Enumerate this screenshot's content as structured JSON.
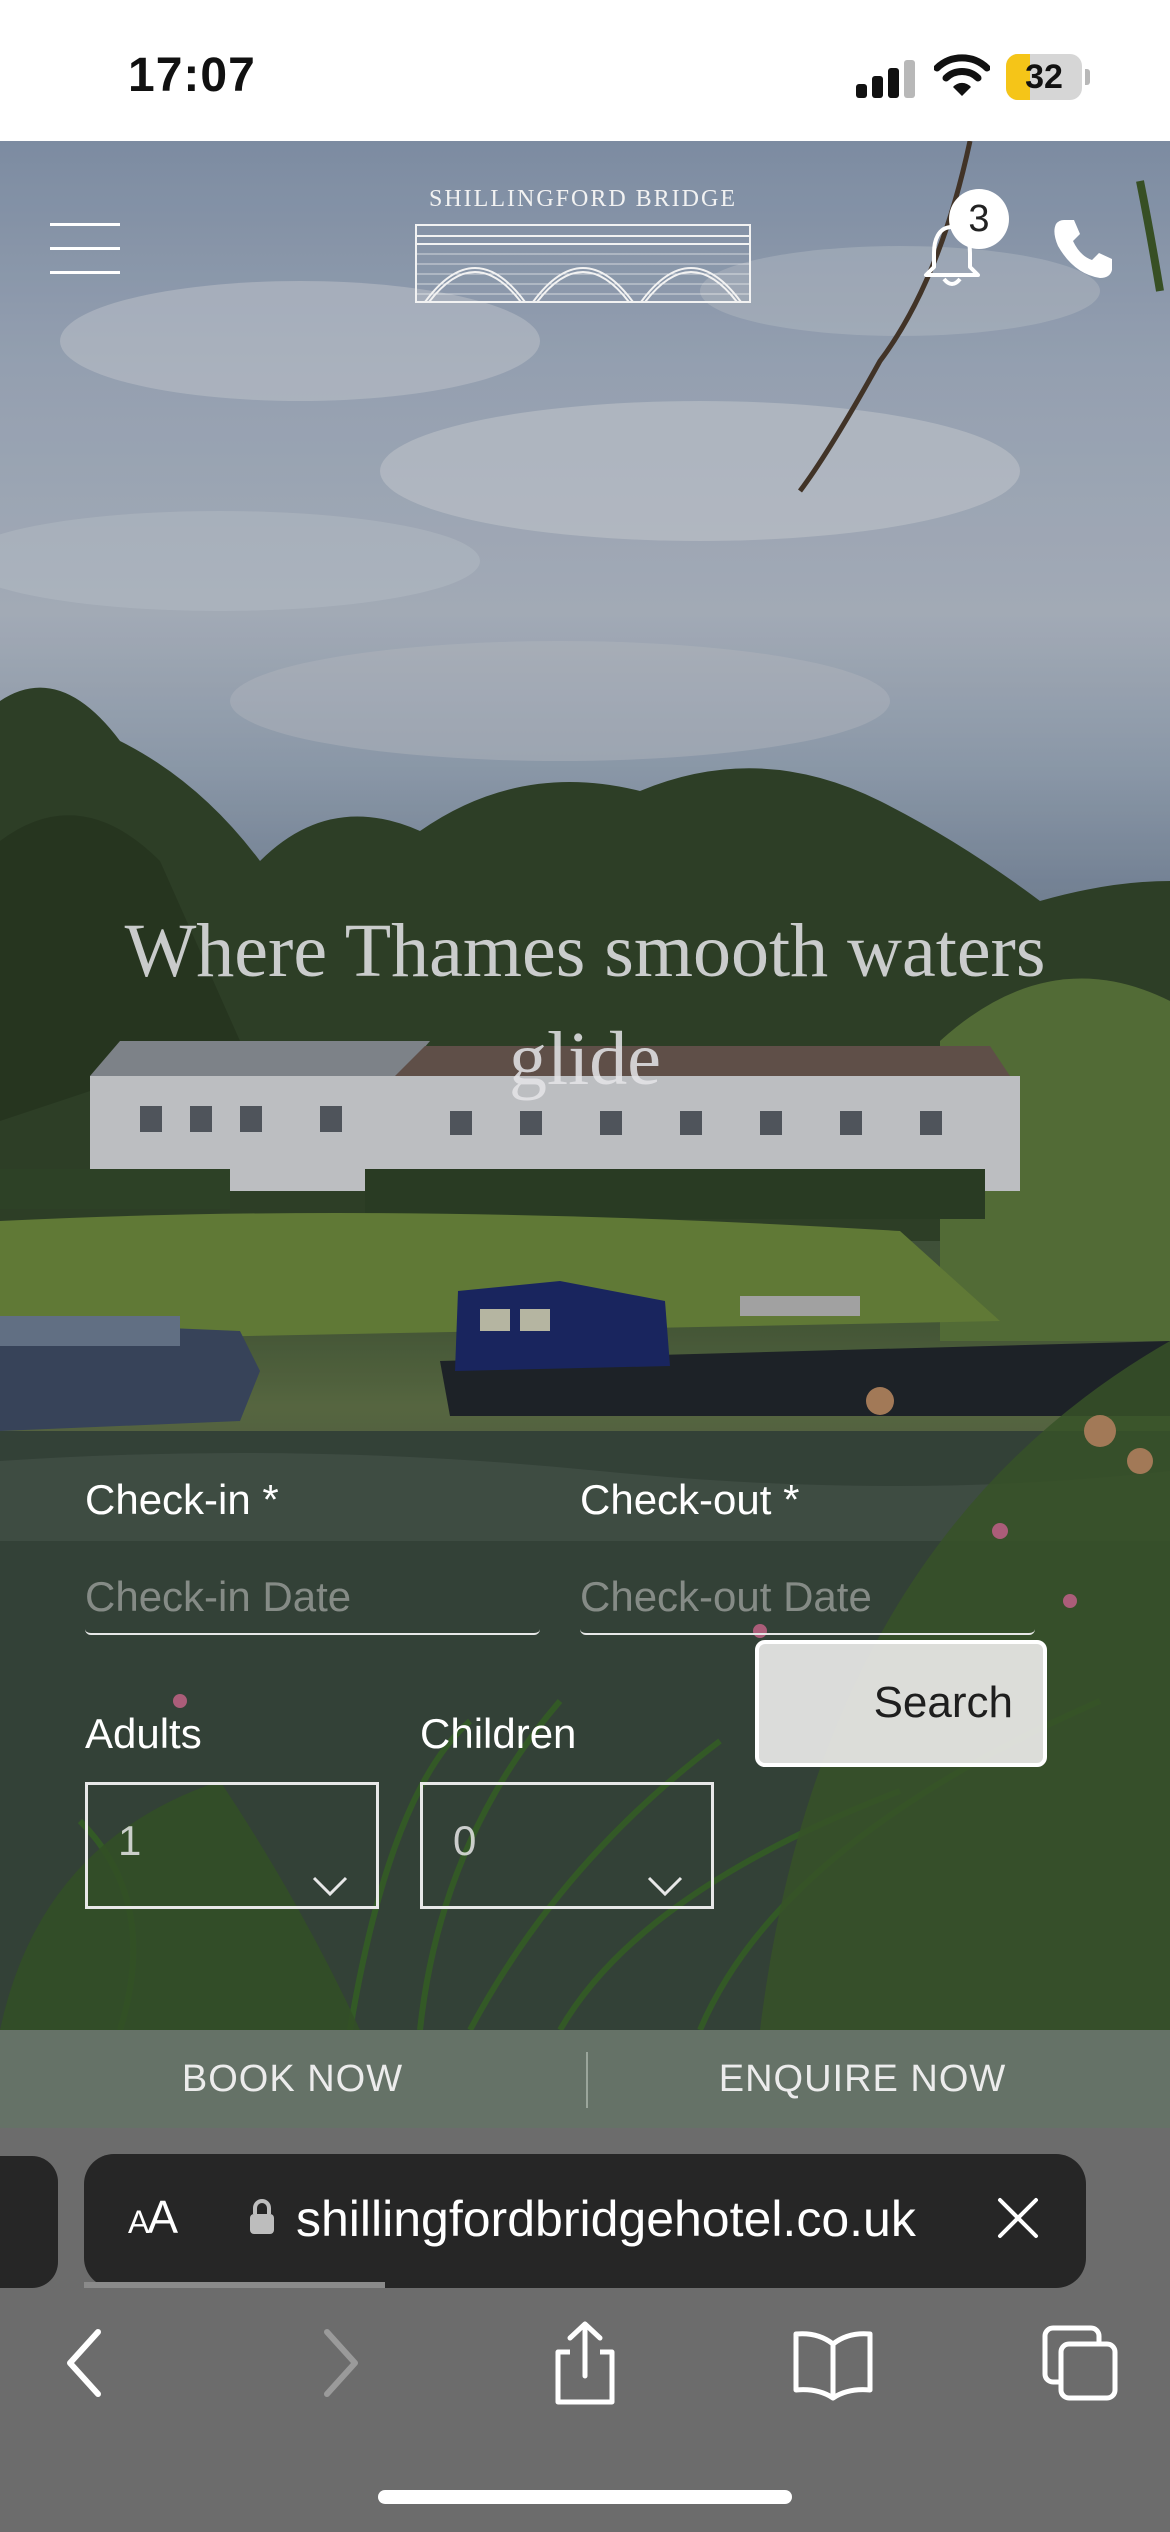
{
  "status_bar": {
    "time": "17:07",
    "battery_level": "32",
    "battery_fraction": 0.32,
    "signal_bars_filled": 3,
    "icons": [
      "cellular-signal-icon",
      "wifi-icon",
      "battery-icon"
    ]
  },
  "header": {
    "logo_text": "SHILLINGFORD BRIDGE",
    "notification_count": "3",
    "icons": [
      "hamburger-menu-icon",
      "bridge-logo",
      "bell-icon",
      "phone-icon"
    ]
  },
  "hero": {
    "headline": "Where Thames smooth waters glide"
  },
  "booking": {
    "checkin_label": "Check-in *",
    "checkin_placeholder": "Check-in Date",
    "checkout_label": "Check-out *",
    "checkout_placeholder": "Check-out Date",
    "adults_label": "Adults",
    "adults_value": "1",
    "children_label": "Children",
    "children_value": "0",
    "search_label": "Search"
  },
  "cta": {
    "book_now": "BOOK NOW",
    "enquire_now": "ENQUIRE NOW"
  },
  "browser": {
    "text_size_label": "AA",
    "url": "shillingfordbridgehotel.co.uk",
    "page_load_progress": 0.3,
    "toolbar_icons": [
      "back-icon",
      "forward-icon",
      "share-icon",
      "bookmarks-icon",
      "tabs-icon"
    ]
  },
  "colors": {
    "cta_bar": "#657267",
    "address_bar": "#262626",
    "battery_fill": "#f5c518"
  }
}
